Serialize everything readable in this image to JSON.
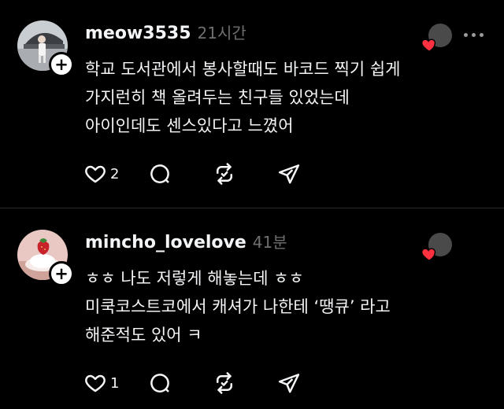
{
  "posts": [
    {
      "username": "meow3535",
      "timestamp": "21시간",
      "lines": [
        "학교 도서관에서 봉사할때도 바코드 찍기 쉽게",
        "가지런히 책 올려두는 친구들 있었는데",
        "아이인데도 센스있다고 느꼈어"
      ],
      "like_count": "2",
      "liked_reaction": true
    },
    {
      "username": "mincho_lovelove",
      "timestamp": "41분",
      "lines": [
        "ㅎㅎ 나도 저렇게 해놓는데 ㅎㅎ",
        "미쿡코스트코에서 캐셔가 나한테 ‘땡큐’ 라고",
        "해준적도 있어 ㅋ"
      ],
      "like_count": "1",
      "liked_reaction": true
    }
  ],
  "icons": {
    "like": "heart-outline-icon",
    "comment": "comment-bubble-icon",
    "repost": "repost-arrows-icon",
    "share": "send-paper-plane-icon",
    "more": "more-dots-icon",
    "follow": "plus-icon",
    "reaction": "red-heart-icon"
  },
  "colors": {
    "background": "#000000",
    "text": "#f3f5f7",
    "muted": "#6f6f6f",
    "heart": "#ff3040"
  }
}
